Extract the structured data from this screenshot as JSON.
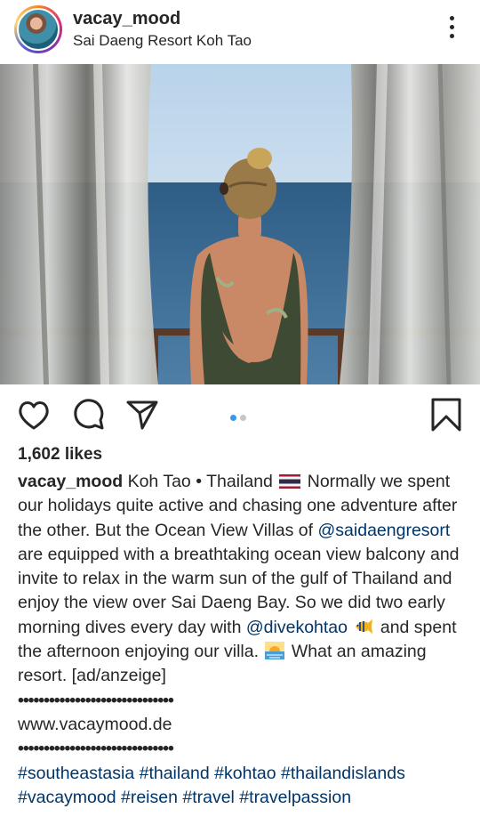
{
  "post": {
    "username": "vacay_mood",
    "location": "Sai Daeng Resort Koh Tao"
  },
  "carousel": {
    "total": 2,
    "current": 1,
    "active_color": "#3897f0",
    "inactive_color": "#c7c7c7"
  },
  "likes": "1,602 likes",
  "caption": {
    "username": "vacay_mood",
    "part1": "Koh Tao • Thailand",
    "part2": "Normally we spent our holidays quite active and chasing one adventure after the other. But the Ocean View Villas of",
    "mention1": "@saidaengresort",
    "part3": "are equipped with a breathtaking ocean view balcony and invite to relax in the warm sun of the gulf of Thailand and enjoy the view over Sai Daeng Bay. So we did two early morning dives every day with",
    "mention2": "@divekohtao",
    "part4": "and spent the afternoon enjoying our villa.",
    "part5": "What an amazing resort. [ad/anzeige]",
    "dots1": "••••••••••••••••••••••••••••••",
    "website": "www.vacaymood.de",
    "dots2": "••••••••••••••••••••••••••••••",
    "hashtags": "#southeastasia #thailand #kohtao #thailandislands #vacaymood #reisen #travel #travelpassion"
  },
  "icons": {
    "header": "more-vertical-icon",
    "flag": "thailand-flag-icon",
    "fish": "tropical-fish-icon",
    "sunrise": "sunrise-icon",
    "actions": [
      "heart-icon",
      "comment-icon",
      "send-icon",
      "bookmark-icon"
    ]
  }
}
